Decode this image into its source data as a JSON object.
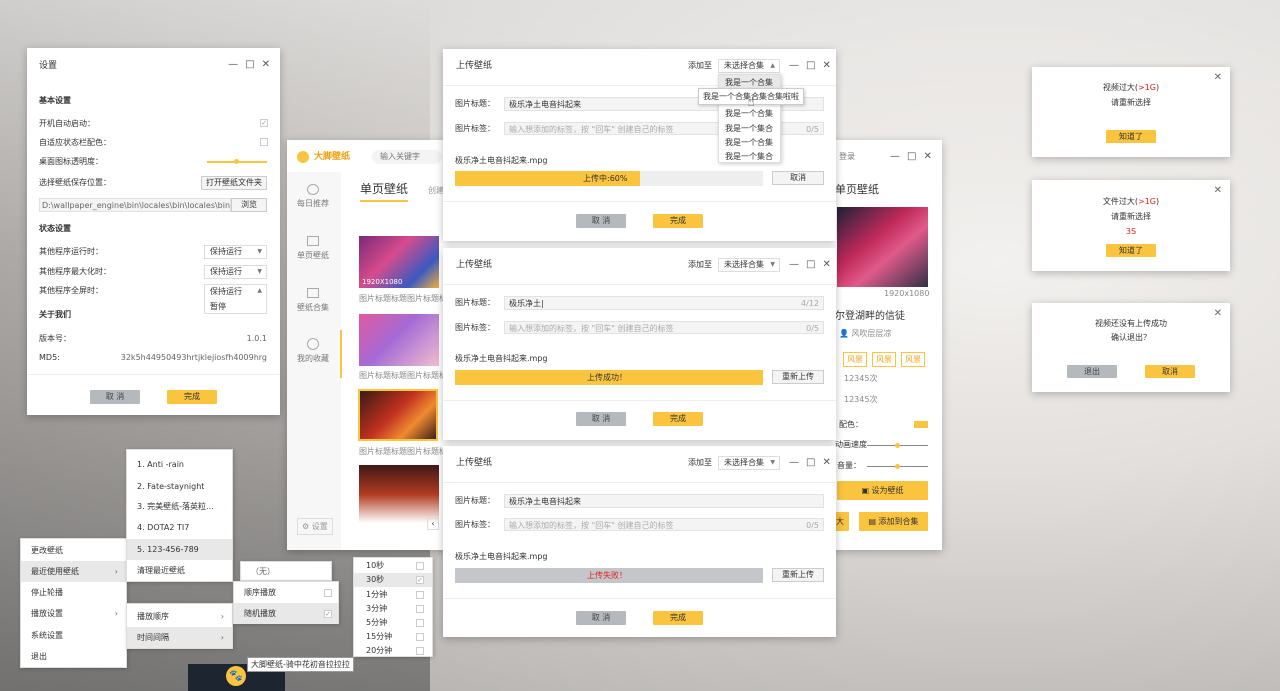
{
  "settings": {
    "title": "设置",
    "basic": "基本设置",
    "autostart": "开机自动启动：",
    "adapt": "自适应状态栏配色：",
    "opacity": "桌面图标透明度：",
    "save_loc": "选择壁纸保存位置：",
    "open_folder": "打开壁纸文件夹",
    "path": "D:\\wallpaper_engine\\bin\\locales\\bin\\locales\\bin",
    "browse": "浏览",
    "status": "状态设置",
    "run": "其他程序运行时：",
    "max": "其他程序最大化时：",
    "full": "其他程序全屏时：",
    "keep": "保持运行",
    "pause": "暂停",
    "about": "关于我们",
    "ver_label": "版本号：",
    "ver": "1.0.1",
    "md5_label": "MD5:",
    "md5": "32k5h44950493hrtjklejiosfh4009hrg",
    "cancel": "取 消",
    "done": "完成"
  },
  "main": {
    "brand": "大脚壁纸",
    "search_ph": "输入关键字",
    "nav": [
      "每日推荐",
      "单页壁纸",
      "壁纸合集",
      "我的收藏"
    ],
    "settings_label": "设置",
    "tab": "单页壁纸",
    "tab2": "创建",
    "res": "1920X1080",
    "cap": "图片标题标题图片标题标题",
    "login": "登录",
    "right_tab": "单页壁纸",
    "right_res": "1920x1080",
    "detail_title": "尔登湖畔的信徒",
    "author": "风吹层层凉",
    "tags": [
      "风景",
      "风景",
      "风景"
    ],
    "count1": "12345次",
    "count2": "12345次",
    "color": "配色：",
    "speed": "动画速度",
    "volume": "音量：",
    "set_btn": "设为壁纸",
    "add_btn": "添加到合集",
    "left_frag": "大"
  },
  "upload1": {
    "title": "上传壁纸",
    "add_to": "添加至",
    "sel": "未选择合集",
    "name_label": "图片标题：",
    "name": "极乐净土电音抖起来",
    "tag_label": "图片标签：",
    "tag_ph": "输入想添加的标签，按 \"回车\" 创建自己的标签",
    "tag_count": "0/5",
    "file": "极乐净土电音抖起来.mpg",
    "progress_text": "上传中:60%",
    "progress": 0.6,
    "cancel_small": "取消",
    "cancel": "取 消",
    "done": "完成",
    "dd": [
      "我是一个合集",
      "我是一个合集合集合集啦啦",
      "我是一个合集",
      "我是一个集合",
      "我是一个合集",
      "我是一个集合"
    ]
  },
  "upload2": {
    "title": "上传壁纸",
    "add_to": "添加至",
    "sel": "未选择合集",
    "name_label": "图片标题：",
    "name": "极乐净土|",
    "name_count": "4/12",
    "tag_label": "图片标签：",
    "tag_ph": "输入想添加的标签，按 \"回车\" 创建自己的标签",
    "tag_count": "0/5",
    "file": "极乐净土电音抖起来.mpg",
    "status": "上传成功！",
    "retry": "重新上传",
    "cancel": "取 消",
    "done": "完成"
  },
  "upload3": {
    "title": "上传壁纸",
    "add_to": "添加至",
    "sel": "未选择合集",
    "name_label": "图片标题：",
    "name": "极乐净土电音抖起来",
    "tag_label": "图片标签：",
    "tag_ph": "输入想添加的标签，按 \"回车\" 创建自己的标签",
    "tag_count": "0/5",
    "file": "极乐净土电音抖起来.mpg",
    "status": "上传失败！",
    "retry": "重新上传",
    "cancel": "取 消",
    "done": "完成"
  },
  "dialogs": [
    {
      "line1a": "视频过大(",
      "line1b": ">1G",
      "line1c": ")",
      "line2": "请重新选择",
      "btn": "知道了"
    },
    {
      "line1a": "文件过大(",
      "line1b": ">1G",
      "line1c": ")",
      "line2": "请重新选择",
      "countdown": "3S",
      "btn": "知道了"
    },
    {
      "line1": "视频还没有上传成功",
      "line2": "确认退出？",
      "btn1": "退出",
      "btn2": "取消"
    }
  ],
  "tray": {
    "items": [
      "更改壁纸",
      "最近使用壁纸",
      "停止轮播",
      "播放设置",
      "系统设置",
      "退出"
    ],
    "recent": [
      "1. Anti -rain",
      "2. Fate-staynight",
      "3. 完美壁纸-落英粒...",
      "4. DOTA2 TI7",
      "5. 123-456-789",
      "清理最近壁纸"
    ],
    "none": "（无）",
    "play": [
      "播放顺序",
      "时间间隔"
    ],
    "order": [
      "顺序播放",
      "随机播放"
    ],
    "intervals": [
      "10秒",
      "30秒",
      "1分钟",
      "3分钟",
      "5分钟",
      "15分钟",
      "20分钟"
    ],
    "tooltip": "大脚壁纸-骑中花初音拉拉拉"
  },
  "colors": {
    "accent": "#fbc43f",
    "danger": "#e02020"
  }
}
